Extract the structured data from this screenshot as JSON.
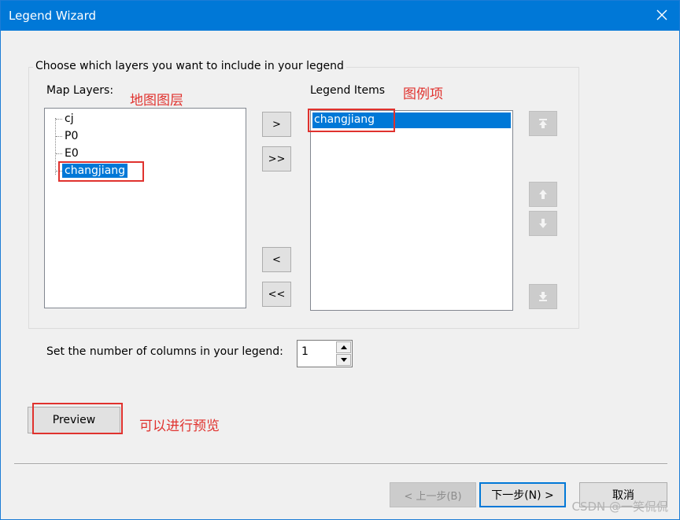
{
  "window": {
    "title": "Legend Wizard"
  },
  "group": {
    "title": "Choose which layers you want to include in your legend"
  },
  "map_layers": {
    "label": "Map Layers:",
    "annotation": "地图图层",
    "items": [
      "cj",
      "P0",
      "E0",
      "changjiang"
    ],
    "selected": "changjiang"
  },
  "legend_items": {
    "label": "Legend Items",
    "annotation": "图例项",
    "items": [
      "changjiang"
    ]
  },
  "transfer_buttons": {
    "add": ">",
    "add_all": ">>",
    "remove": "<",
    "remove_all": "<<"
  },
  "order_buttons": {
    "top": "move-to-top-icon",
    "up": "move-up-icon",
    "down": "move-down-icon",
    "bottom": "move-to-bottom-icon"
  },
  "columns": {
    "label": "Set the number of columns in your legend:",
    "value": "1"
  },
  "preview": {
    "label": "Preview",
    "annotation": "可以进行预览"
  },
  "footer": {
    "back_label": "< 上一步(B)",
    "next_label": "下一步(N) >",
    "cancel_label": "取消"
  },
  "watermark": "CSDN @一笑侃侃",
  "colors": {
    "titlebar": "#0078d7",
    "selection": "#0078d7",
    "annotation_red": "#e0322e"
  }
}
